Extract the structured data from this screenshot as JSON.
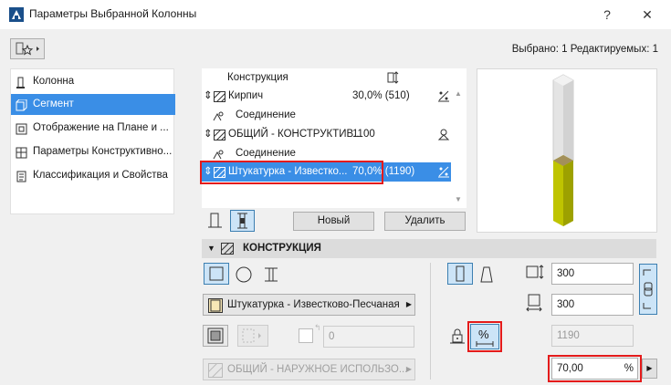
{
  "window": {
    "title": "Параметры Выбранной Колонны",
    "help_glyph": "?",
    "close_glyph": "✕"
  },
  "toolbar": {
    "selection_info": "Выбрано: 1 Редактируемых: 1"
  },
  "nav": {
    "items": [
      {
        "label": "Колонна",
        "icon": "column-icon",
        "active": false
      },
      {
        "label": "Сегмент",
        "icon": "segment-icon",
        "active": true
      },
      {
        "label": "Отображение на Плане и ...",
        "icon": "floorplan-icon",
        "active": false
      },
      {
        "label": "Параметры Конструктивно...",
        "icon": "structural-icon",
        "active": false
      },
      {
        "label": "Классификация и Свойства",
        "icon": "classification-icon",
        "active": false
      }
    ]
  },
  "layers": {
    "header": {
      "name": "Конструкция"
    },
    "rows": [
      {
        "type": "component",
        "name": "Кирпич",
        "value": "30,0% (510)"
      },
      {
        "type": "joint",
        "name": "Соединение",
        "value": ""
      },
      {
        "type": "component",
        "name": "ОБЩИЙ - КОНСТРУКТИВ...",
        "value": "1100"
      },
      {
        "type": "joint",
        "name": "Соединение",
        "value": ""
      },
      {
        "type": "component",
        "name": "Штукатурка - Известко...",
        "value": "70,0% (1190)",
        "selected": true
      }
    ],
    "new_button": "Новый",
    "delete_button": "Удалить"
  },
  "construction": {
    "title": "КОНСТРУКЦИЯ",
    "material_dropdown": "Штукатурка - Известково-Песчаная",
    "core_value": "0",
    "building_material_dropdown": "ОБЩИЙ - НАРУЖНОЕ ИСПОЛЬЗО...",
    "width": "300",
    "depth": "300",
    "height_readonly": "1190",
    "percent_value": "70,00",
    "percent_unit": "%",
    "percent_symbol": "%"
  },
  "preview": {
    "segment_percentages": [
      30,
      70
    ],
    "colors": {
      "top": "#dcdcdc",
      "bottom": "#bfc400",
      "accent": "#3a8ee6",
      "highlight": "#e41b1b"
    }
  }
}
